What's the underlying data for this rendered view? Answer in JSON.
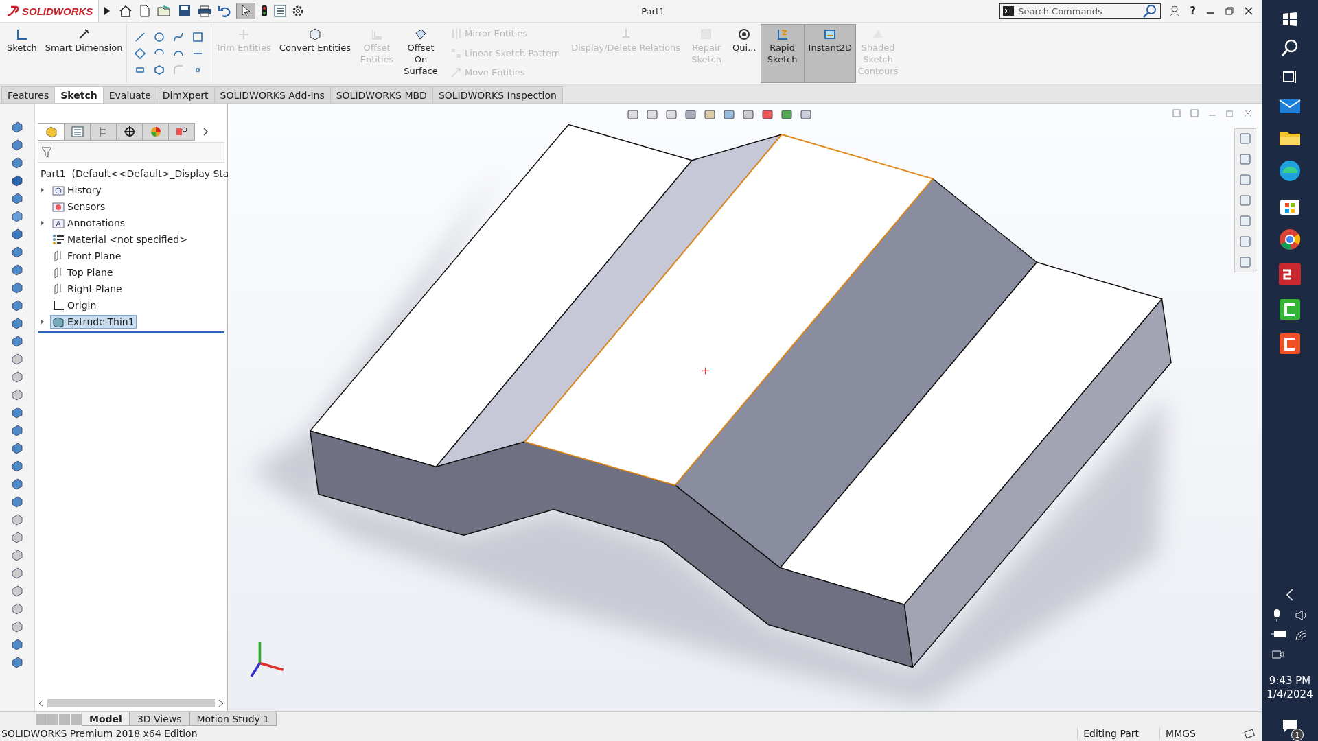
{
  "title_bar": {
    "logo": "SOLIDWORKS",
    "document": "Part1",
    "search": {
      "placeholder": "Search Commands"
    },
    "help": "?"
  },
  "command_manager": {
    "tools": [
      {
        "label": "Sketch",
        "kind": "large",
        "enabled": true,
        "selected": false
      },
      {
        "label": "Smart Dimension",
        "kind": "large",
        "enabled": true,
        "selected": false
      },
      {
        "label": "Trim Entities",
        "kind": "large",
        "enabled": false,
        "selected": false
      },
      {
        "label": "Convert Entities",
        "kind": "large",
        "enabled": true,
        "selected": false
      },
      {
        "label": "Offset Entities",
        "kind": "stacked",
        "enabled": false,
        "selected": false
      },
      {
        "label": "Offset On Surface",
        "kind": "stacked",
        "enabled": true,
        "selected": false
      },
      {
        "label": "Mirror Entities",
        "kind": "small",
        "enabled": false,
        "selected": false
      },
      {
        "label": "Linear Sketch Pattern",
        "kind": "small",
        "enabled": false,
        "selected": false
      },
      {
        "label": "Move Entities",
        "kind": "small",
        "enabled": false,
        "selected": false
      },
      {
        "label": "Display/Delete Relations",
        "kind": "large",
        "enabled": false,
        "selected": false
      },
      {
        "label": "Repair Sketch",
        "kind": "stacked",
        "enabled": false,
        "selected": false
      },
      {
        "label": "Qui...",
        "kind": "large",
        "enabled": true,
        "selected": false
      },
      {
        "label": "Rapid Sketch",
        "kind": "stacked",
        "enabled": true,
        "selected": true
      },
      {
        "label": "Instant2D",
        "kind": "large",
        "enabled": true,
        "selected": true
      },
      {
        "label": "Shaded Sketch Contours",
        "kind": "stacked",
        "enabled": false,
        "selected": false
      }
    ]
  },
  "tabs": [
    {
      "label": "Features",
      "selected": false
    },
    {
      "label": "Sketch",
      "selected": true
    },
    {
      "label": "Evaluate",
      "selected": false
    },
    {
      "label": "DimXpert",
      "selected": false
    },
    {
      "label": "SOLIDWORKS Add-Ins",
      "selected": false
    },
    {
      "label": "SOLIDWORKS MBD",
      "selected": false
    },
    {
      "label": "SOLIDWORKS Inspection",
      "selected": false
    }
  ],
  "feature_tree": {
    "root": "Part1",
    "root_config": "(Default<<Default>_Display Sta",
    "items": [
      {
        "label": "History",
        "kind": "history",
        "expandable": true,
        "selected": false
      },
      {
        "label": "Sensors",
        "kind": "sensors",
        "expandable": false,
        "selected": false
      },
      {
        "label": "Annotations",
        "kind": "annotations",
        "expandable": true,
        "selected": false
      },
      {
        "label": "Material <not specified>",
        "kind": "material",
        "expandable": false,
        "selected": false
      },
      {
        "label": "Front Plane",
        "kind": "plane",
        "expandable": false,
        "selected": false
      },
      {
        "label": "Top Plane",
        "kind": "plane",
        "expandable": false,
        "selected": false
      },
      {
        "label": "Right Plane",
        "kind": "plane",
        "expandable": false,
        "selected": false
      },
      {
        "label": "Origin",
        "kind": "origin",
        "expandable": false,
        "selected": false
      },
      {
        "label": "Extrude-Thin1",
        "kind": "extrude",
        "expandable": true,
        "selected": true
      }
    ]
  },
  "bottom_tabs": [
    {
      "label": "Model",
      "selected": true
    },
    {
      "label": "3D Views",
      "selected": false
    },
    {
      "label": "Motion Study 1",
      "selected": false
    }
  ],
  "status_bar": {
    "edition": "SOLIDWORKS Premium 2018 x64 Edition",
    "mode": "Editing Part",
    "units": "MMGS"
  },
  "taskbar": {
    "time": "9:43 PM",
    "date": "1/4/2024",
    "notifications": "1"
  }
}
